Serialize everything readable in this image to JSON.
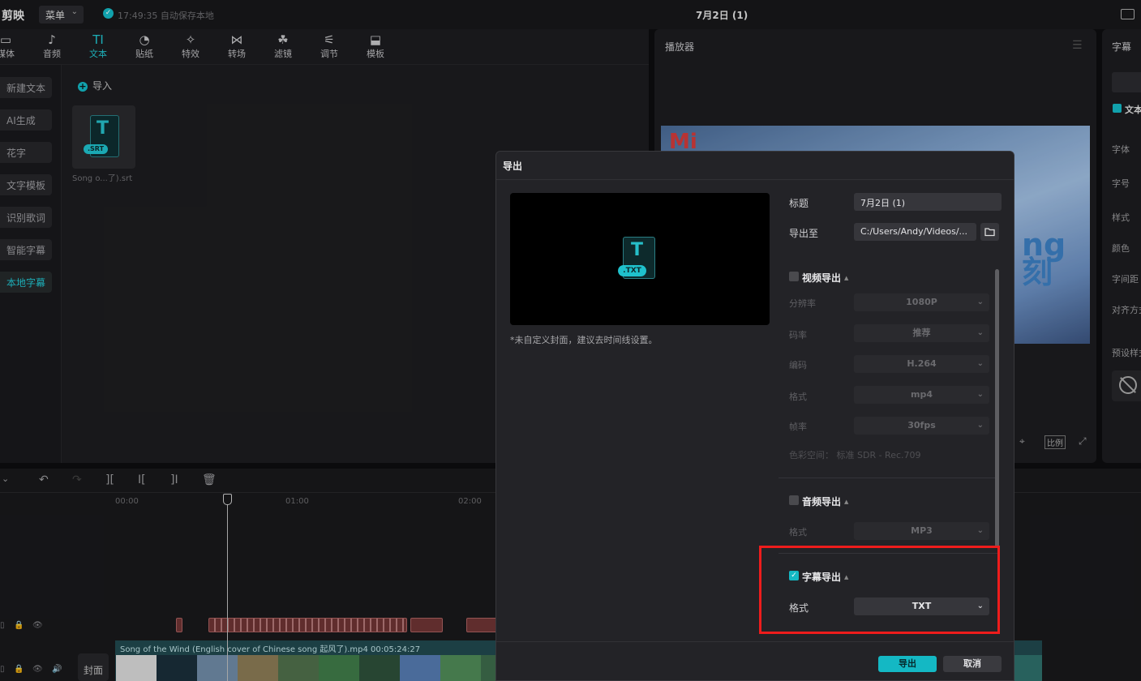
{
  "app": {
    "name": "剪映",
    "menu_label": "菜单",
    "autosave": "17:49:35 自动保存本地",
    "doc_title": "7月2日 (1)"
  },
  "tools": [
    {
      "label": "媒体",
      "icon": "▭"
    },
    {
      "label": "音频",
      "icon": "♪"
    },
    {
      "label": "文本",
      "icon": "TI"
    },
    {
      "label": "贴纸",
      "icon": "◔"
    },
    {
      "label": "特效",
      "icon": "✧"
    },
    {
      "label": "转场",
      "icon": "⋈"
    },
    {
      "label": "滤镜",
      "icon": "☘"
    },
    {
      "label": "调节",
      "icon": "⚟"
    },
    {
      "label": "模板",
      "icon": "⬓"
    }
  ],
  "sidenav": [
    "新建文本",
    "AI生成",
    "花字",
    "文字模板",
    "识别歌词",
    "智能字幕",
    "本地字幕"
  ],
  "media": {
    "import_label": "导入",
    "srt_badge": ".SRT",
    "srt_name": "Song o...了).srt"
  },
  "player": {
    "title": "播放器",
    "ratio": "比例",
    "video_mark": "Mi",
    "video_text": "ng\n刻"
  },
  "right_panel": {
    "title": "字幕",
    "labels": [
      "文本",
      "字体",
      "字号",
      "样式",
      "颜色",
      "字间距",
      "对齐方式",
      "预设样式"
    ]
  },
  "timeline": {
    "ticks": [
      "00:00",
      "01:00",
      "02:00"
    ],
    "video_clip_label": "Song of the Wind (English cover of Chinese song 起风了).mp4   00:05:24:27",
    "cover_label": "封面"
  },
  "dialog": {
    "title": "导出",
    "cover_badge": ".TXT",
    "cover_note": "*未自定义封面，建议去时间线设置。",
    "title_label": "标题",
    "title_value": "7月2日 (1)",
    "export_to_label": "导出至",
    "export_to_value": "C:/Users/Andy/Videos/...",
    "video_section": {
      "label": "视频导出",
      "checked": false,
      "fields": [
        {
          "label": "分辨率",
          "value": "1080P"
        },
        {
          "label": "码率",
          "value": "推荐"
        },
        {
          "label": "编码",
          "value": "H.264"
        },
        {
          "label": "格式",
          "value": "mp4"
        },
        {
          "label": "帧率",
          "value": "30fps"
        }
      ],
      "color_space": "色彩空间：  标准 SDR - Rec.709"
    },
    "audio_section": {
      "label": "音频导出",
      "checked": false,
      "format_label": "格式",
      "format_value": "MP3"
    },
    "subtitle_section": {
      "label": "字幕导出",
      "checked": true,
      "format_label": "格式",
      "format_value": "TXT"
    },
    "export_button": "导出",
    "cancel_button": "取消"
  },
  "colors": {
    "accent": "#14b8c4",
    "highlight": "#ee1c1c"
  }
}
